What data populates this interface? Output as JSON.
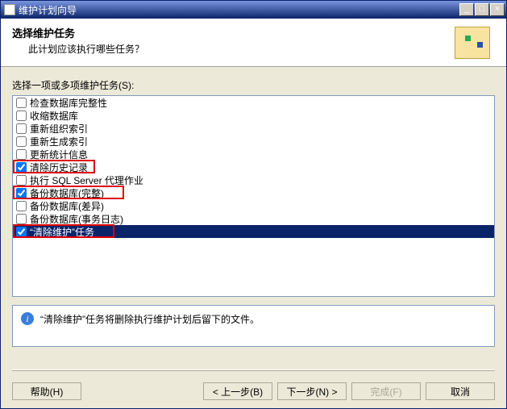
{
  "window": {
    "title": "维护计划向导",
    "controls": {
      "min": "_",
      "max": "□",
      "close": "×"
    }
  },
  "header": {
    "title": "选择维护任务",
    "subtitle": "此计划应该执行哪些任务？"
  },
  "body": {
    "instruction": "选择一项或多项维护任务(S):",
    "items": [
      {
        "label": "检查数据库完整性",
        "checked": false
      },
      {
        "label": "收缩数据库",
        "checked": false
      },
      {
        "label": "重新组织索引",
        "checked": false
      },
      {
        "label": "重新生成索引",
        "checked": false
      },
      {
        "label": "更新统计信息",
        "checked": false
      },
      {
        "label": "清除历史记录",
        "checked": true,
        "highlight": true
      },
      {
        "label": "执行 SQL Server 代理作业",
        "checked": false
      },
      {
        "label": "备份数据库(完整)",
        "checked": true,
        "highlight": true
      },
      {
        "label": "备份数据库(差异)",
        "checked": false
      },
      {
        "label": "备份数据库(事务日志)",
        "checked": false
      },
      {
        "label": "“清除维护”任务",
        "checked": true,
        "highlight": true,
        "selected": true
      }
    ],
    "description": "“清除维护”任务将删除执行维护计划后留下的文件。"
  },
  "footer": {
    "help": "帮助(H)",
    "back": "< 上一步(B)",
    "next": "下一步(N) >",
    "finish": "完成(F)",
    "cancel": "取消"
  },
  "icons": {
    "info": "i"
  }
}
